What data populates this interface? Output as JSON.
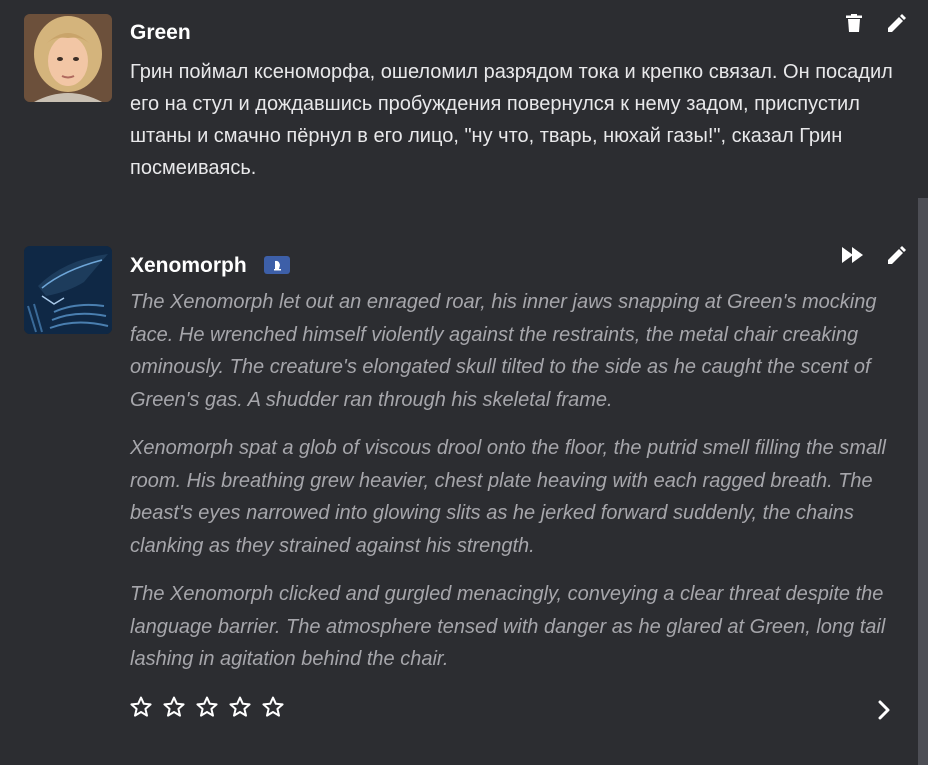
{
  "messages": {
    "green": {
      "name": "Green",
      "text": "Грин поймал ксеноморфа, ошеломил разрядом тока и крепко связал. Он посадил его на стул и дождавшись пробуждения повернулся к нему задом, приспустил штаны и смачно пёрнул в его лицо, \"ну что, тварь, нюхай газы!\", сказал Грин посмеиваясь.",
      "actions": [
        "trash-icon",
        "pencil-icon"
      ]
    },
    "xeno": {
      "name": "Xenomorph",
      "badge_icon": "bot-badge-icon",
      "paragraphs": [
        "The Xenomorph let out an enraged roar, his inner jaws snapping at Green's mocking face. He wrenched himself violently against the restraints, the metal chair creaking ominously. The creature's elongated skull tilted to the side as he caught the scent of Green's gas. A shudder ran through his skeletal frame.",
        "Xenomorph spat a glob of viscous drool onto the floor, the putrid smell filling the small room. His breathing grew heavier, chest plate heaving with each ragged breath. The beast's eyes narrowed into glowing slits as he jerked forward suddenly, the chains clanking as they strained against his strength.",
        "The Xenomorph clicked and gurgled menacingly, conveying a clear threat despite the language barrier. The atmosphere tensed with danger as he glared at Green, long tail lashing in agitation behind the chair."
      ],
      "actions": [
        "fast-forward-icon",
        "pencil-icon"
      ],
      "rating": {
        "value": 0,
        "max": 5
      },
      "next_icon": "chevron-right-icon"
    }
  },
  "colors": {
    "background": "#2c2d31",
    "name": "#ffffff",
    "user_text": "#e8e8ea",
    "bot_text": "#a6a6ab",
    "badge": "#3d5fa8",
    "scroll_thumb": "#4d4e55"
  }
}
